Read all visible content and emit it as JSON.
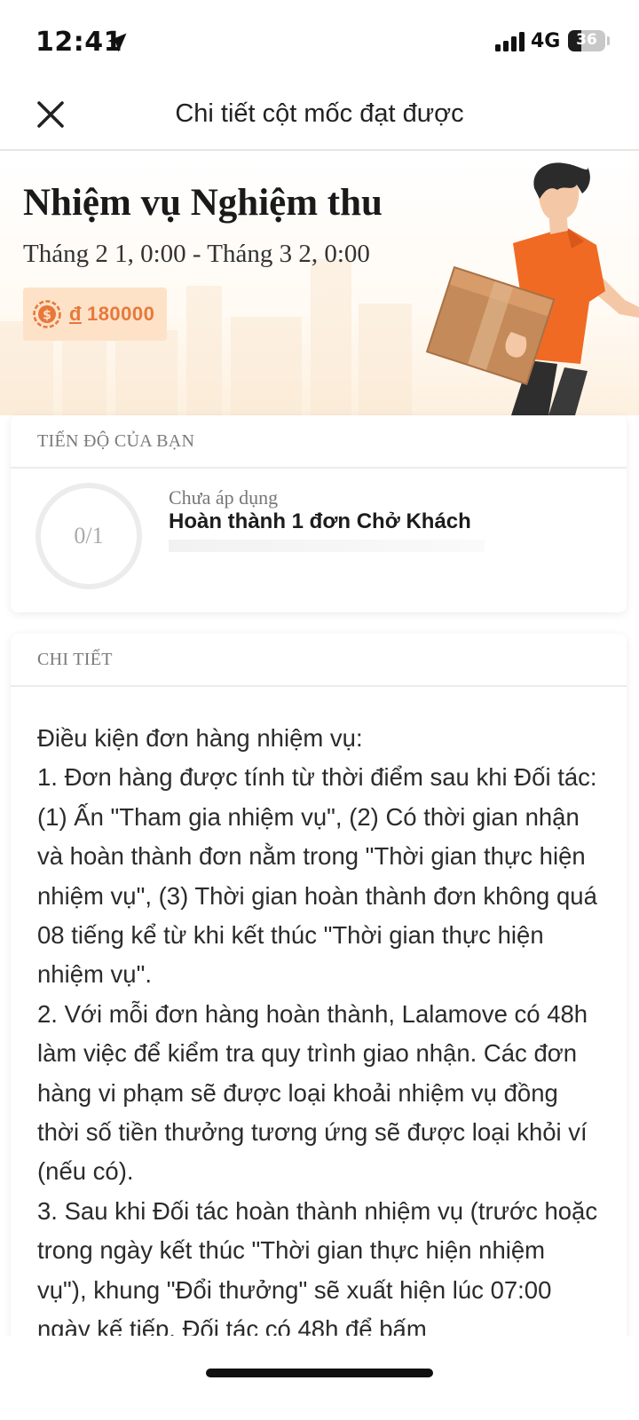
{
  "status_bar": {
    "time": "12:41",
    "network": "4G",
    "battery_level": "36",
    "battery_fraction": 0.36,
    "location_icon": "location-arrow-icon",
    "signal_icon": "cellular-signal-icon"
  },
  "header": {
    "title": "Chi tiết cột mốc đạt được",
    "close_icon": "close-icon"
  },
  "hero": {
    "title": "Nhiệm vụ Nghiệm thu",
    "dates": "Tháng 2 1, 0:00 - Tháng 3 2, 0:00",
    "reward_currency": "đ",
    "reward_amount": "180000",
    "coin_icon": "coin-icon",
    "illustration": "courier-carrying-box-illustration"
  },
  "progress": {
    "heading": "TIẾN ĐỘ CỦA BẠN",
    "ring_label": "0/1",
    "status": "Chưa áp dụng",
    "task": "Hoàn thành 1 đơn Chở Khách"
  },
  "details": {
    "heading": "CHI TIẾT",
    "lines": [
      "Điều kiện đơn hàng nhiệm vụ:",
      "1. Đơn hàng được tính từ thời điểm sau khi Đối tác: (1) Ấn \"Tham gia nhiệm vụ\", (2) Có thời gian nhận và hoàn thành đơn nằm trong \"Thời gian thực hiện nhiệm vụ\", (3) Thời gian hoàn thành đơn không quá 08 tiếng kể từ khi kết thúc \"Thời gian thực hiện nhiệm vụ\".",
      "2. Với mỗi đơn hàng hoàn thành, Lalamove có 48h làm việc để kiểm tra quy trình giao nhận. Các đơn hàng vi phạm sẽ được loại khoải nhiệm vụ đồng thời số tiền thưởng tương ứng sẽ được loại khỏi ví (nếu có).",
      "3. Sau khi Đối tác hoàn thành nhiệm vụ (trước hoặc trong ngày kết thúc \"Thời gian thực hiện nhiệm vụ\"), khung \"Đổi thưởng\" sẽ xuất hiện lúc 07:00 ngày kế tiếp. Đối tác có 48h để bấm"
    ]
  },
  "colors": {
    "accent": "#e8783a",
    "badge_bg": "#fde2c8",
    "courier_shirt": "#f06a24",
    "box": "#c48a5a"
  }
}
